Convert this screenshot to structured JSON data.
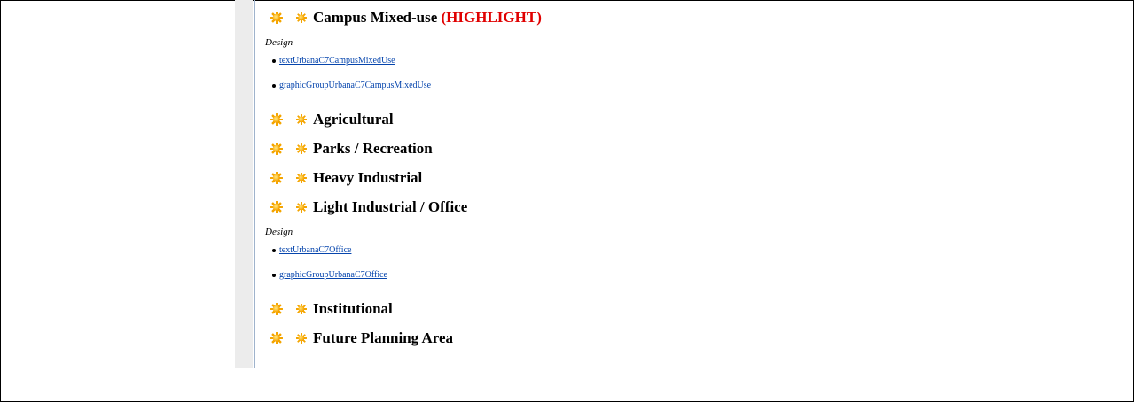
{
  "sections": [
    {
      "title": "Campus Mixed-use",
      "highlight": "(HIGHLIGHT)",
      "design": {
        "label": "Design",
        "links": [
          "textUrbanaC7CampusMixedUse",
          "graphicGroupUrbanaC7CampusMixedUse"
        ]
      }
    },
    {
      "title": "Agricultural"
    },
    {
      "title": "Parks / Recreation"
    },
    {
      "title": "Heavy Industrial"
    },
    {
      "title": "Light Industrial / Office",
      "design": {
        "label": "Design",
        "links": [
          "textUrbanaC7Office",
          "graphicGroupUrbanaC7Office"
        ]
      }
    },
    {
      "title": "Institutional"
    },
    {
      "title": "Future Planning Area"
    }
  ],
  "icons": {
    "expand": "sun-icon",
    "node": "sun-icon"
  },
  "colors": {
    "highlight": "#e00000",
    "link": "#0645ad",
    "icon": "#f4a500",
    "gutter": "#ececec"
  }
}
